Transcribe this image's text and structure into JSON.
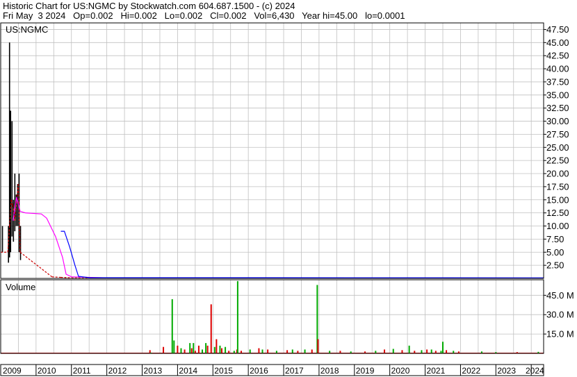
{
  "header": {
    "line1": "Historic Chart for US:NGMC by Stockwatch.com 604.687.1500 - (c) 2024",
    "line2": "Fri May  3 2024   Op=0.002   Hi=0.002   Lo=0.002   Cl=0.002   Vol=6,430   Year hi=45.00   lo=0.0001"
  },
  "colors": {
    "price_bar": "#000000",
    "close_marker": "#cc0000",
    "ma_short": "#ff00ff",
    "ma_long": "#0000ff",
    "volume_up": "#00aa00",
    "volume_down": "#dd0000",
    "grid": "#c0c0c0",
    "frame": "#000000"
  },
  "chart_data": [
    {
      "type": "line",
      "title": "US:NGMC",
      "ylim": [
        0,
        48.75
      ],
      "y_ticks": [
        "2.50",
        "5.00",
        "7.50",
        "10.00",
        "12.50",
        "15.00",
        "17.50",
        "20.00",
        "22.50",
        "25.00",
        "27.50",
        "30.00",
        "32.50",
        "35.00",
        "37.50",
        "40.00",
        "42.50",
        "45.00",
        "47.50"
      ],
      "price_bars": [
        {
          "x": 2009.05,
          "high": 10.0,
          "low": 5.0
        },
        {
          "x": 2009.22,
          "high": 10.0,
          "low": 3.0
        },
        {
          "x": 2009.25,
          "high": 45.0,
          "low": 4.0
        },
        {
          "x": 2009.28,
          "high": 32.0,
          "low": 5.0
        },
        {
          "x": 2009.32,
          "high": 30.0,
          "low": 8.0
        },
        {
          "x": 2009.36,
          "high": 15.0,
          "low": 7.0
        },
        {
          "x": 2009.4,
          "high": 20.0,
          "low": 9.0
        },
        {
          "x": 2009.44,
          "high": 16.0,
          "low": 10.0
        },
        {
          "x": 2009.48,
          "high": 18.0,
          "low": 10.0
        },
        {
          "x": 2009.52,
          "high": 20.0,
          "low": 5.0
        },
        {
          "x": 2009.56,
          "high": 10.0,
          "low": 3.5
        }
      ],
      "close_series": [
        {
          "x": 2009.0,
          "y": 5.0
        },
        {
          "x": 2009.2,
          "y": 5.0
        },
        {
          "x": 2009.25,
          "y": 10.0
        },
        {
          "x": 2009.3,
          "y": 15.0
        },
        {
          "x": 2009.34,
          "y": 14.0
        },
        {
          "x": 2009.4,
          "y": 11.0
        },
        {
          "x": 2009.45,
          "y": 15.0
        },
        {
          "x": 2009.5,
          "y": 18.0
        },
        {
          "x": 2009.55,
          "y": 5.0
        },
        {
          "x": 2010.45,
          "y": 0.3
        },
        {
          "x": 2010.7,
          "y": 0.2
        },
        {
          "x": 2011.0,
          "y": 0.1
        },
        {
          "x": 2011.5,
          "y": 0.05
        }
      ],
      "ma_short": [
        {
          "x": 2009.35,
          "y": 11.0
        },
        {
          "x": 2009.45,
          "y": 15.5
        },
        {
          "x": 2009.55,
          "y": 12.8
        },
        {
          "x": 2009.7,
          "y": 12.5
        },
        {
          "x": 2010.15,
          "y": 12.3
        },
        {
          "x": 2010.3,
          "y": 11.5
        },
        {
          "x": 2010.55,
          "y": 8.0
        },
        {
          "x": 2010.75,
          "y": 4.0
        },
        {
          "x": 2010.85,
          "y": 0.8
        },
        {
          "x": 2011.0,
          "y": 0.3
        },
        {
          "x": 2012.0,
          "y": 0.1
        },
        {
          "x": 2024.35,
          "y": 0.05
        }
      ],
      "ma_long": [
        {
          "x": 2010.7,
          "y": 9.0
        },
        {
          "x": 2010.8,
          "y": 9.0
        },
        {
          "x": 2010.95,
          "y": 6.0
        },
        {
          "x": 2011.1,
          "y": 2.5
        },
        {
          "x": 2011.2,
          "y": 0.4
        },
        {
          "x": 2011.5,
          "y": 0.15
        },
        {
          "x": 2024.35,
          "y": 0.1
        }
      ]
    },
    {
      "type": "bar",
      "title": "Volume",
      "ylim": [
        0,
        57
      ],
      "y_ticks": [
        "15.0 M",
        "30.0 M",
        "45.0 M"
      ],
      "x_ticks": [
        "2009",
        "2010",
        "2011",
        "2012",
        "2013",
        "2014",
        "2015",
        "2016",
        "2017",
        "2018",
        "2019",
        "2020",
        "2021",
        "2022",
        "2023",
        "2024"
      ],
      "bars": [
        {
          "x": 2013.22,
          "v": 2.5,
          "up": false
        },
        {
          "x": 2013.25,
          "v": 0.6,
          "up": true
        },
        {
          "x": 2013.6,
          "v": 5.0,
          "up": false
        },
        {
          "x": 2013.85,
          "v": 42.0,
          "up": true
        },
        {
          "x": 2013.9,
          "v": 10.0,
          "up": true
        },
        {
          "x": 2014.0,
          "v": 6.0,
          "up": false
        },
        {
          "x": 2014.1,
          "v": 4.0,
          "up": true
        },
        {
          "x": 2014.2,
          "v": 3.0,
          "up": false
        },
        {
          "x": 2014.35,
          "v": 8.0,
          "up": true
        },
        {
          "x": 2014.4,
          "v": 4.0,
          "up": false
        },
        {
          "x": 2014.45,
          "v": 8.0,
          "up": true
        },
        {
          "x": 2014.5,
          "v": 2.0,
          "up": false
        },
        {
          "x": 2014.6,
          "v": 6.0,
          "up": false
        },
        {
          "x": 2014.7,
          "v": 3.0,
          "up": true
        },
        {
          "x": 2014.8,
          "v": 8.0,
          "up": true
        },
        {
          "x": 2014.85,
          "v": 6.0,
          "up": false
        },
        {
          "x": 2014.95,
          "v": 38.0,
          "up": false
        },
        {
          "x": 2015.05,
          "v": 5.0,
          "up": true
        },
        {
          "x": 2015.1,
          "v": 11.0,
          "up": false
        },
        {
          "x": 2015.2,
          "v": 6.0,
          "up": true
        },
        {
          "x": 2015.25,
          "v": 4.0,
          "up": false
        },
        {
          "x": 2015.35,
          "v": 5.0,
          "up": true
        },
        {
          "x": 2015.45,
          "v": 2.0,
          "up": false
        },
        {
          "x": 2015.6,
          "v": 2.0,
          "up": true
        },
        {
          "x": 2015.68,
          "v": 3.0,
          "up": false
        },
        {
          "x": 2015.7,
          "v": 56.0,
          "up": true
        },
        {
          "x": 2015.8,
          "v": 2.0,
          "up": false
        },
        {
          "x": 2016.05,
          "v": 3.0,
          "up": true
        },
        {
          "x": 2016.3,
          "v": 4.0,
          "up": false
        },
        {
          "x": 2016.4,
          "v": 3.0,
          "up": true
        },
        {
          "x": 2016.55,
          "v": 3.0,
          "up": false
        },
        {
          "x": 2016.8,
          "v": 2.0,
          "up": true
        },
        {
          "x": 2017.1,
          "v": 2.5,
          "up": false
        },
        {
          "x": 2017.25,
          "v": 3.0,
          "up": true
        },
        {
          "x": 2017.4,
          "v": 2.0,
          "up": false
        },
        {
          "x": 2017.6,
          "v": 3.0,
          "up": true
        },
        {
          "x": 2017.8,
          "v": 3.0,
          "up": false
        },
        {
          "x": 2017.95,
          "v": 53.0,
          "up": true
        },
        {
          "x": 2017.97,
          "v": 11.0,
          "up": false
        },
        {
          "x": 2018.3,
          "v": 2.0,
          "up": true
        },
        {
          "x": 2018.6,
          "v": 2.0,
          "up": false
        },
        {
          "x": 2018.9,
          "v": 1.5,
          "up": true
        },
        {
          "x": 2019.3,
          "v": 1.5,
          "up": false
        },
        {
          "x": 2019.6,
          "v": 2.0,
          "up": true
        },
        {
          "x": 2019.85,
          "v": 3.0,
          "up": false
        },
        {
          "x": 2020.1,
          "v": 3.5,
          "up": true
        },
        {
          "x": 2020.35,
          "v": 2.5,
          "up": false
        },
        {
          "x": 2020.55,
          "v": 6.0,
          "up": true
        },
        {
          "x": 2020.7,
          "v": 2.0,
          "up": false
        },
        {
          "x": 2020.9,
          "v": 2.5,
          "up": true
        },
        {
          "x": 2021.05,
          "v": 3.0,
          "up": false
        },
        {
          "x": 2021.18,
          "v": 3.0,
          "up": true
        },
        {
          "x": 2021.3,
          "v": 2.0,
          "up": false
        },
        {
          "x": 2021.45,
          "v": 2.0,
          "up": true
        },
        {
          "x": 2021.5,
          "v": 9.0,
          "up": true
        },
        {
          "x": 2021.6,
          "v": 2.5,
          "up": false
        },
        {
          "x": 2021.8,
          "v": 2.0,
          "up": true
        },
        {
          "x": 2021.95,
          "v": 1.5,
          "up": false
        },
        {
          "x": 2022.6,
          "v": 1.5,
          "up": true
        },
        {
          "x": 2023.0,
          "v": 1.0,
          "up": true
        },
        {
          "x": 2023.6,
          "v": 1.0,
          "up": false
        },
        {
          "x": 2024.2,
          "v": 1.2,
          "up": true
        }
      ]
    }
  ]
}
